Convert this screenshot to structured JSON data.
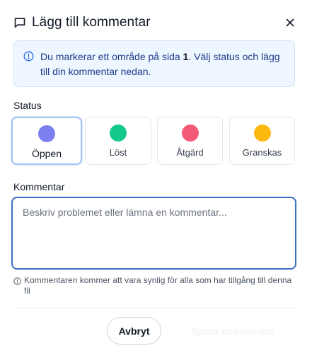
{
  "dialog": {
    "title": "Lägg till kommentar",
    "close_icon": "close-icon"
  },
  "info": {
    "text_before": "Du markerar ett område på sida ",
    "page_number": "1",
    "text_after": ". Välj status och lägg till din kommentar nedan.",
    "icon": "info-icon"
  },
  "status": {
    "label": "Status",
    "selected": "Öppen",
    "options": [
      {
        "label": "Öppen",
        "color": "#7b7ff0"
      },
      {
        "label": "Löst",
        "color": "#12c98a"
      },
      {
        "label": "Åtgärd",
        "color": "#f25a76"
      },
      {
        "label": "Granskas",
        "color": "#fdb90f"
      }
    ]
  },
  "comment": {
    "label": "Kommentar",
    "placeholder": "Beskriv problemet eller lämna en kommentar...",
    "value": "",
    "hint": "Kommentaren kommer att vara synlig för alla som har tillgång till denna fil"
  },
  "actions": {
    "cancel": "Avbryt",
    "submit": "Spara kommentar"
  },
  "colors": {
    "accent": "#3b6fc0",
    "info_bg": "#eef6ff",
    "info_text": "#1e3a8a"
  }
}
